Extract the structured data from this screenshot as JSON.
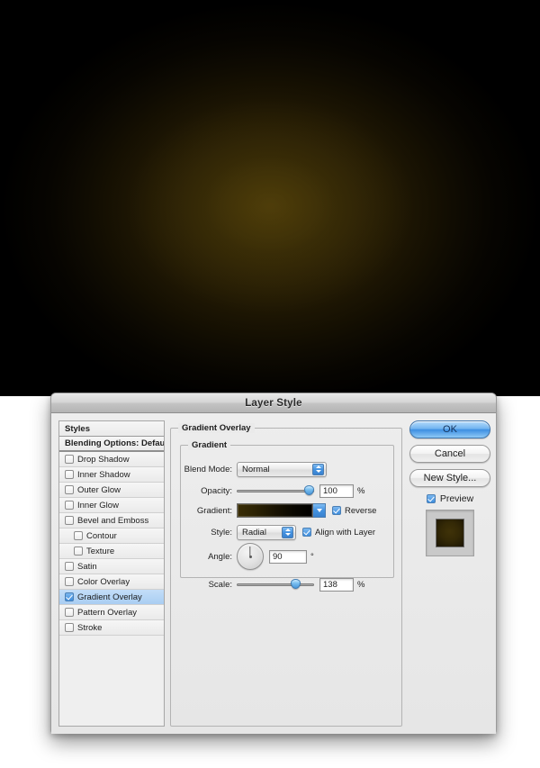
{
  "artwork": {
    "name": "radial-amber-glow-canvas",
    "background_color": "#000000",
    "glow_center_color": "#3e3007",
    "glow_edge_color": "#000000"
  },
  "dialog": {
    "title": "Layer Style"
  },
  "styles_panel": {
    "header": "Styles",
    "blending_options": "Blending Options: Default",
    "items": [
      {
        "label": "Drop Shadow",
        "checked": false,
        "indent": false,
        "selected": false
      },
      {
        "label": "Inner Shadow",
        "checked": false,
        "indent": false,
        "selected": false
      },
      {
        "label": "Outer Glow",
        "checked": false,
        "indent": false,
        "selected": false
      },
      {
        "label": "Inner Glow",
        "checked": false,
        "indent": false,
        "selected": false
      },
      {
        "label": "Bevel and Emboss",
        "checked": false,
        "indent": false,
        "selected": false
      },
      {
        "label": "Contour",
        "checked": false,
        "indent": true,
        "selected": false
      },
      {
        "label": "Texture",
        "checked": false,
        "indent": true,
        "selected": false
      },
      {
        "label": "Satin",
        "checked": false,
        "indent": false,
        "selected": false
      },
      {
        "label": "Color Overlay",
        "checked": false,
        "indent": false,
        "selected": false
      },
      {
        "label": "Gradient Overlay",
        "checked": true,
        "indent": false,
        "selected": true
      },
      {
        "label": "Pattern Overlay",
        "checked": false,
        "indent": false,
        "selected": false
      },
      {
        "label": "Stroke",
        "checked": false,
        "indent": false,
        "selected": false
      }
    ],
    "selection_color": "#a9cdf2"
  },
  "options": {
    "outer_group_legend": "Gradient Overlay",
    "inner_group_legend": "Gradient",
    "blend_mode": {
      "label": "Blend Mode:",
      "value": "Normal"
    },
    "opacity": {
      "label": "Opacity:",
      "value": "100",
      "unit": "%",
      "percent": 100
    },
    "gradient": {
      "label": "Gradient:",
      "swatch_start_color": "#3a2d06",
      "swatch_end_color": "#000000",
      "reverse_label": "Reverse",
      "reverse_checked": true
    },
    "style": {
      "label": "Style:",
      "value": "Radial",
      "align_label": "Align with Layer",
      "align_checked": true
    },
    "angle": {
      "label": "Angle:",
      "value": "90",
      "unit": "°"
    },
    "scale": {
      "label": "Scale:",
      "value": "138",
      "unit": "%",
      "percent": 69
    }
  },
  "buttons": {
    "ok": "OK",
    "cancel": "Cancel",
    "new_style": "New Style...",
    "preview_label": "Preview",
    "preview_checked": true
  }
}
